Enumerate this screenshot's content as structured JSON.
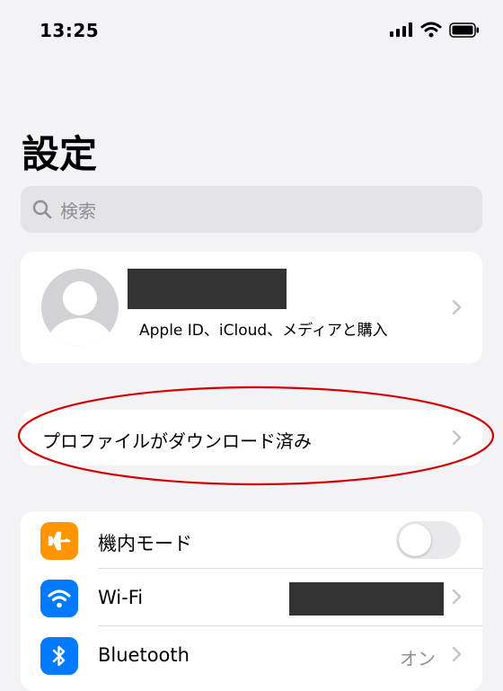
{
  "status_bar": {
    "time": "13:25"
  },
  "header": {
    "title": "設定"
  },
  "search": {
    "placeholder": "検索"
  },
  "profile": {
    "subtitle": "Apple ID、iCloud、メディアと購入"
  },
  "profile_download": {
    "label": "プロファイルがダウンロード済み"
  },
  "settings": {
    "airplane_mode": {
      "label": "機内モード",
      "enabled": false,
      "icon_color": "#ff9500"
    },
    "wifi": {
      "label": "Wi-Fi",
      "icon_color": "#007aff"
    },
    "bluetooth": {
      "label": "Bluetooth",
      "value": "オン",
      "icon_color": "#007aff"
    }
  },
  "colors": {
    "background": "#f2f2f7",
    "highlight": "#d40000",
    "chevron": "#c4c4c7"
  }
}
